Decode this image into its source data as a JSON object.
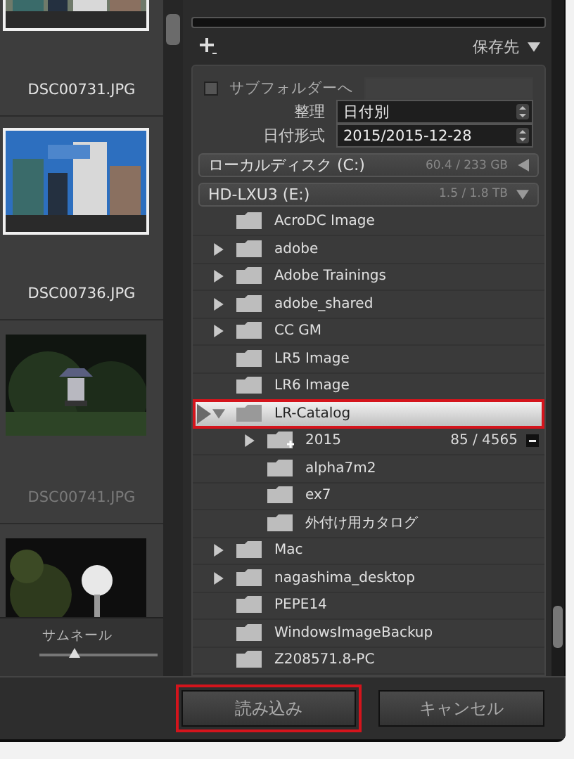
{
  "filmstrip": {
    "items": [
      {
        "file": "DSC00731.JPG",
        "selected": true,
        "dimmed": false
      },
      {
        "file": "DSC00736.JPG",
        "selected": true,
        "dimmed": false
      },
      {
        "file": "DSC00741.JPG",
        "selected": false,
        "dimmed": true
      },
      {
        "selected": false
      }
    ],
    "thumbnail_size": {
      "label": "サムネール",
      "level": 0.3
    }
  },
  "destination": {
    "title": "保存先",
    "subfolder": {
      "label": "サブフォルダーへ",
      "checked": false
    },
    "organize": {
      "label": "整理",
      "value": "日付別"
    },
    "date_format": {
      "label": "日付形式",
      "value": "2015/2015-12-28"
    },
    "volumes": [
      {
        "name": "ローカルディスク (C:)",
        "space": "60.4 / 233 GB",
        "expanded": false
      },
      {
        "name": "HD-LXU3 (E:)",
        "space": "1.5 / 1.8 TB",
        "expanded": true
      }
    ],
    "folders": [
      {
        "name": "AcroDC Image",
        "has_children": false,
        "selected": false
      },
      {
        "name": "adobe",
        "has_children": true,
        "expanded": false,
        "selected": false
      },
      {
        "name": "Adobe Trainings",
        "has_children": true,
        "expanded": false,
        "selected": false
      },
      {
        "name": "adobe_shared",
        "has_children": true,
        "expanded": false,
        "selected": false
      },
      {
        "name": "CC GM",
        "has_children": true,
        "expanded": false,
        "selected": false
      },
      {
        "name": "LR5 Image",
        "has_children": false,
        "selected": false
      },
      {
        "name": "LR6 Image",
        "has_children": false,
        "selected": false
      },
      {
        "name": "LR-Catalog",
        "has_children": true,
        "expanded": true,
        "selected": true,
        "highlighted": true,
        "children": [
          {
            "name": "2015",
            "count": "85 / 4565",
            "has_children": true,
            "expanded": false,
            "selected": false,
            "new": true
          },
          {
            "name": "alpha7m2",
            "has_children": false,
            "selected": false
          },
          {
            "name": "ex7",
            "has_children": false,
            "selected": false
          },
          {
            "name": "外付け用カタログ",
            "has_children": false,
            "selected": false
          }
        ]
      },
      {
        "name": "Mac",
        "has_children": true,
        "expanded": false,
        "selected": false
      },
      {
        "name": "nagashima_desktop",
        "has_children": true,
        "expanded": false,
        "selected": false
      },
      {
        "name": "PEPE14",
        "has_children": false,
        "selected": false
      },
      {
        "name": "WindowsImageBackup",
        "has_children": false,
        "selected": false
      },
      {
        "name": "Z208571.8-PC",
        "has_children": false,
        "selected": false
      }
    ]
  },
  "buttons": [
    {
      "label": "読み込み",
      "highlighted": true
    },
    {
      "label": "キャンセル",
      "highlighted": false
    }
  ]
}
